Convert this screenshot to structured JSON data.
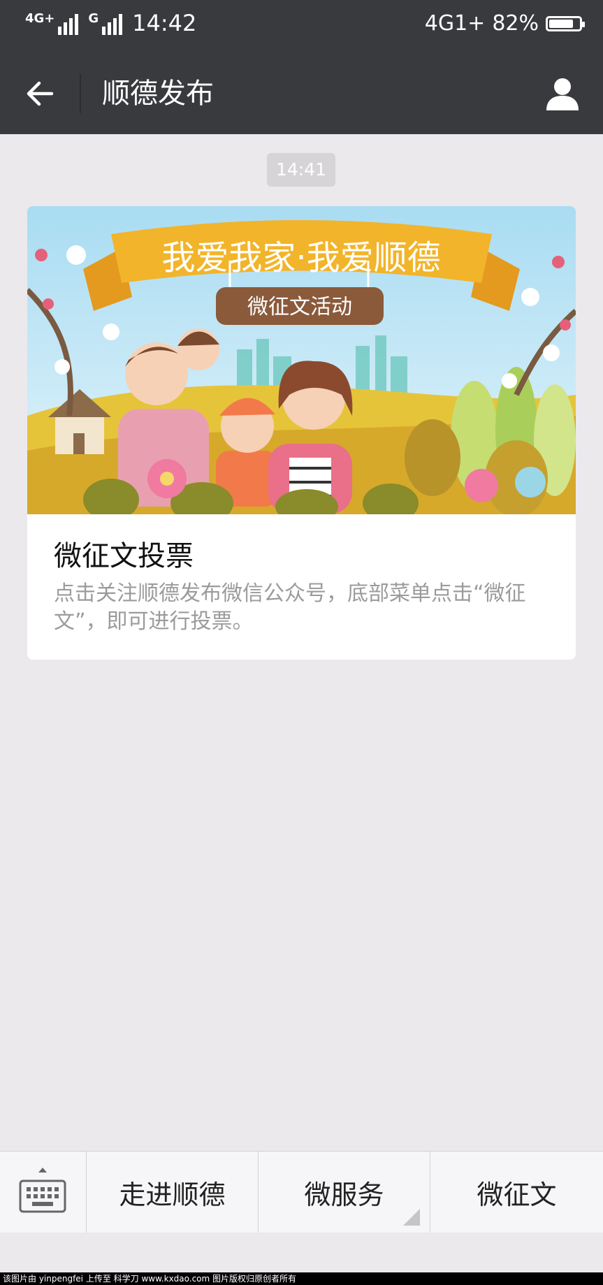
{
  "status_bar": {
    "net1": "4G+",
    "net2": "G",
    "time": "14:42",
    "right_net": "4G1+",
    "battery": "82%",
    "battery_level": 0.82
  },
  "header": {
    "back_icon": "arrow-left-icon",
    "title": "顺德发布",
    "profile_icon": "person-icon"
  },
  "chat": {
    "timestamp": "14:41"
  },
  "article": {
    "banner_title": "我爱我家·我爱顺德",
    "banner_sign": "微征文活动",
    "title": "微征文投票",
    "description": "点击关注顺德发布微信公众号，底部菜单点击“微征文”，即可进行投票。"
  },
  "bottom_menu": {
    "keyboard_icon": "keyboard-icon",
    "items": [
      "走进顺德",
      "微服务",
      "微征文"
    ]
  },
  "watermark": "该图片由 yinpengfei 上传至 科学刀 www.kxdao.com 图片版权归原创者所有",
  "colors": {
    "header_bg": "#393a3e",
    "page_bg": "#ebe9ec",
    "banner_ribbon": "#f2b42a",
    "banner_sky": "#bfe4f2"
  }
}
